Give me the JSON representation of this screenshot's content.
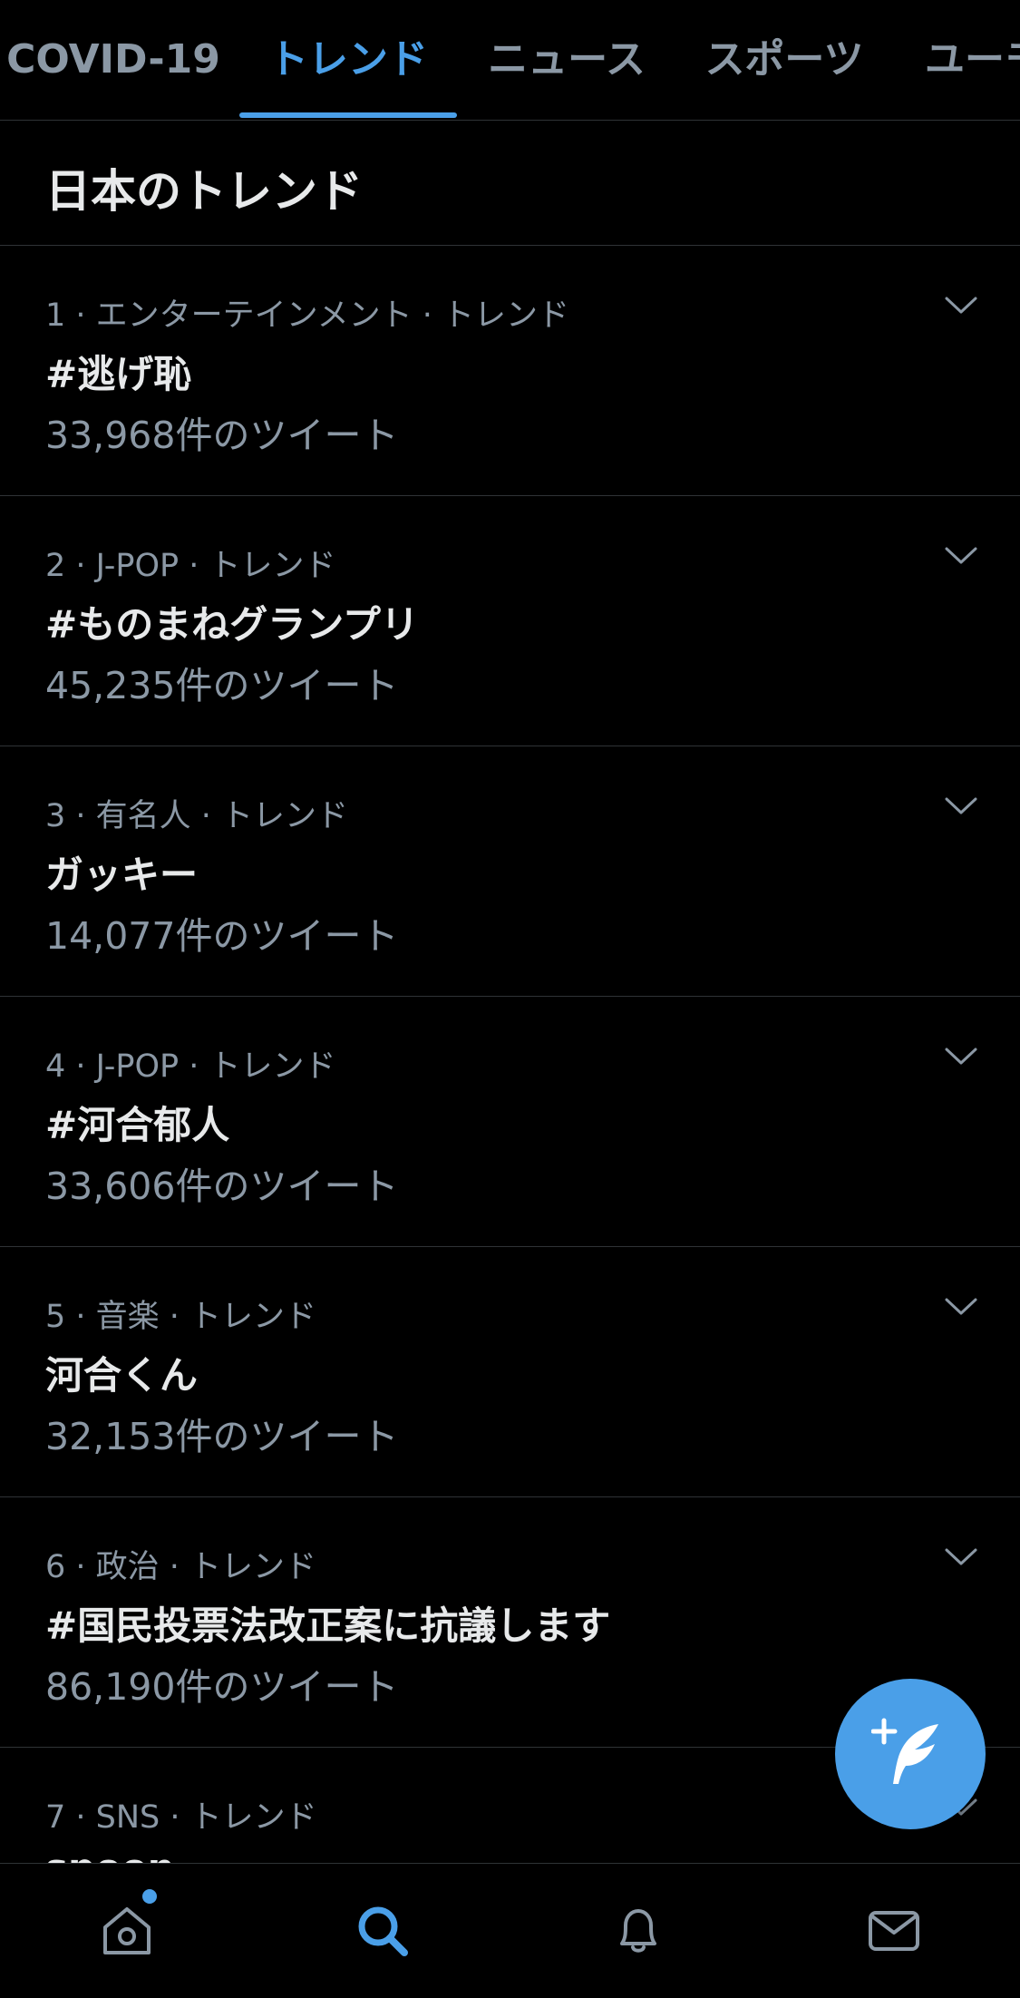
{
  "tabs": [
    {
      "label": "COVID-19",
      "active": false
    },
    {
      "label": "トレンド",
      "active": true
    },
    {
      "label": "ニュース",
      "active": false
    },
    {
      "label": "スポーツ",
      "active": false
    },
    {
      "label": "ユーモア",
      "active": false
    }
  ],
  "section": {
    "title": "日本のトレンド"
  },
  "trends": [
    {
      "meta": "1 · エンターテインメント · トレンド",
      "name": "#逃げ恥",
      "count": "33,968件のツイート"
    },
    {
      "meta": "2 · J-POP · トレンド",
      "name": "#ものまねグランプリ",
      "count": "45,235件のツイート"
    },
    {
      "meta": "3 · 有名人 · トレンド",
      "name": "ガッキー",
      "count": "14,077件のツイート"
    },
    {
      "meta": "4 · J-POP · トレンド",
      "name": "#河合郁人",
      "count": "33,606件のツイート"
    },
    {
      "meta": "5 · 音楽 · トレンド",
      "name": "河合くん",
      "count": "32,153件のツイート"
    },
    {
      "meta": "6 · 政治 · トレンド",
      "name": "#国民投票法改正案に抗議します",
      "count": "86,190件のツイート"
    },
    {
      "meta": "7 · SNS · トレンド",
      "name": "spoon",
      "count": ""
    }
  ],
  "colors": {
    "accent": "#4a9fe8",
    "background": "#000000",
    "muted": "#8b98a5",
    "text": "#e7e9ea",
    "divider": "#2f3336"
  },
  "icons": {
    "fab": "compose-feather-icon",
    "nav": [
      "home-icon",
      "search-icon",
      "bell-icon",
      "mail-icon"
    ],
    "chevron": "chevron-down-icon"
  },
  "nav": {
    "home_has_notification": true,
    "active": "search"
  }
}
